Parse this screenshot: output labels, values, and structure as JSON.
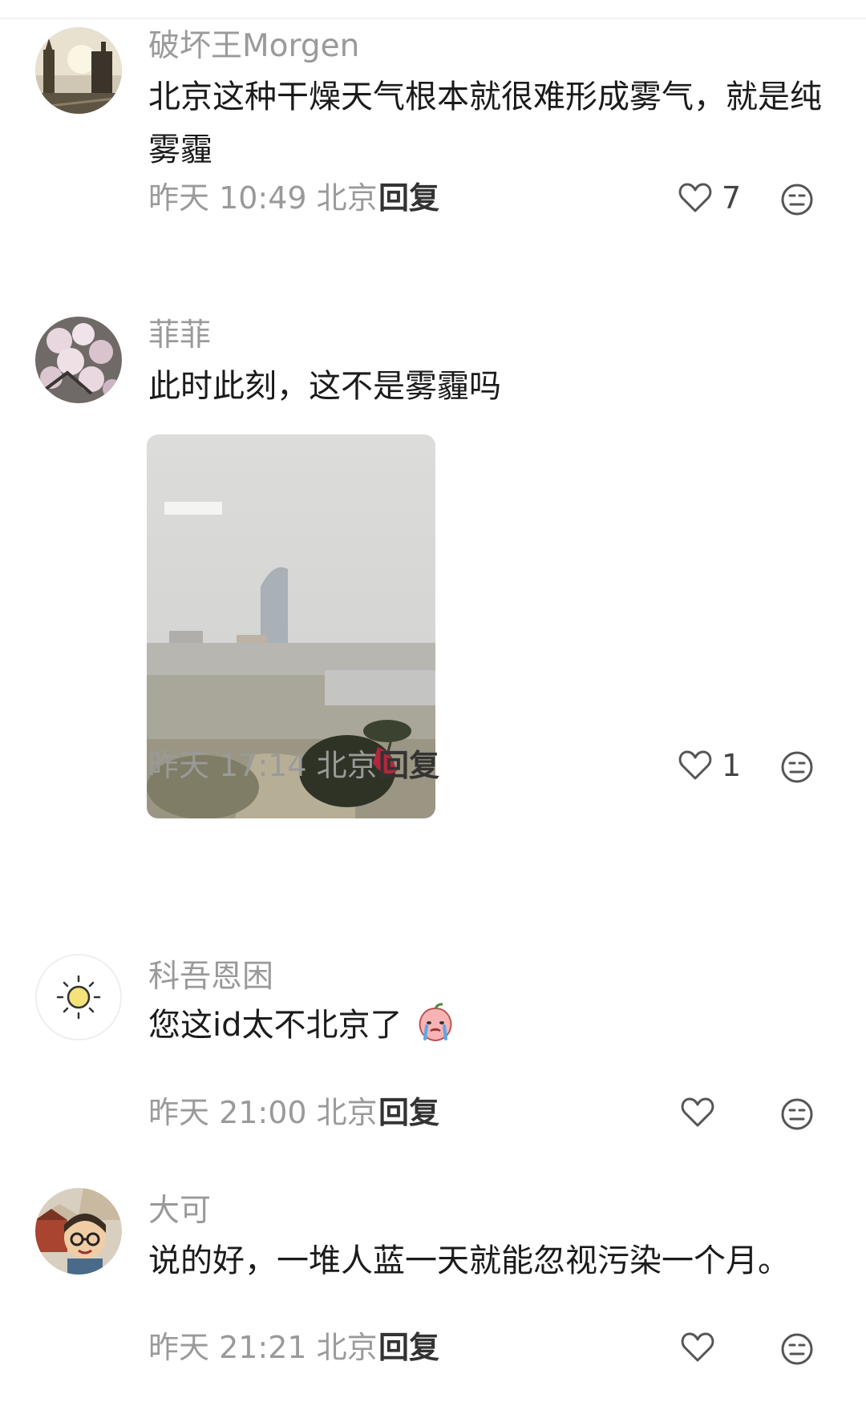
{
  "comments": [
    {
      "username": "破坏王Morgen",
      "text": "北京这种干燥天气根本就很难形成雾气，就是纯雾霾",
      "time": "昨天 10:49 北京",
      "reply_label": "回复",
      "likes": "7",
      "avatar_icon": "city-street-avatar"
    },
    {
      "username": "菲菲",
      "text": "此时此刻，这不是雾霾吗",
      "time": "昨天 17:14 北京",
      "reply_label": "回复",
      "likes": "1",
      "avatar_icon": "flower-avatar",
      "has_photo": true
    },
    {
      "username": "科吾恩困",
      "text": "您这id太不北京了",
      "time": "昨天 21:00 北京",
      "reply_label": "回复",
      "likes": "",
      "avatar_icon": "sun-avatar",
      "trailing_emoji": "crying-peach-emoji"
    },
    {
      "username": "大可",
      "text": "说的好，一堆人蓝一天就能忽视污染一个月。",
      "time": "昨天 21:21 北京",
      "reply_label": "回复",
      "likes": "",
      "avatar_icon": "cartoon-person-avatar"
    }
  ],
  "colors": {
    "secondary_text": "#9a9a9a",
    "primary_text": "#1b1b1b",
    "icon_stroke": "#555555"
  }
}
